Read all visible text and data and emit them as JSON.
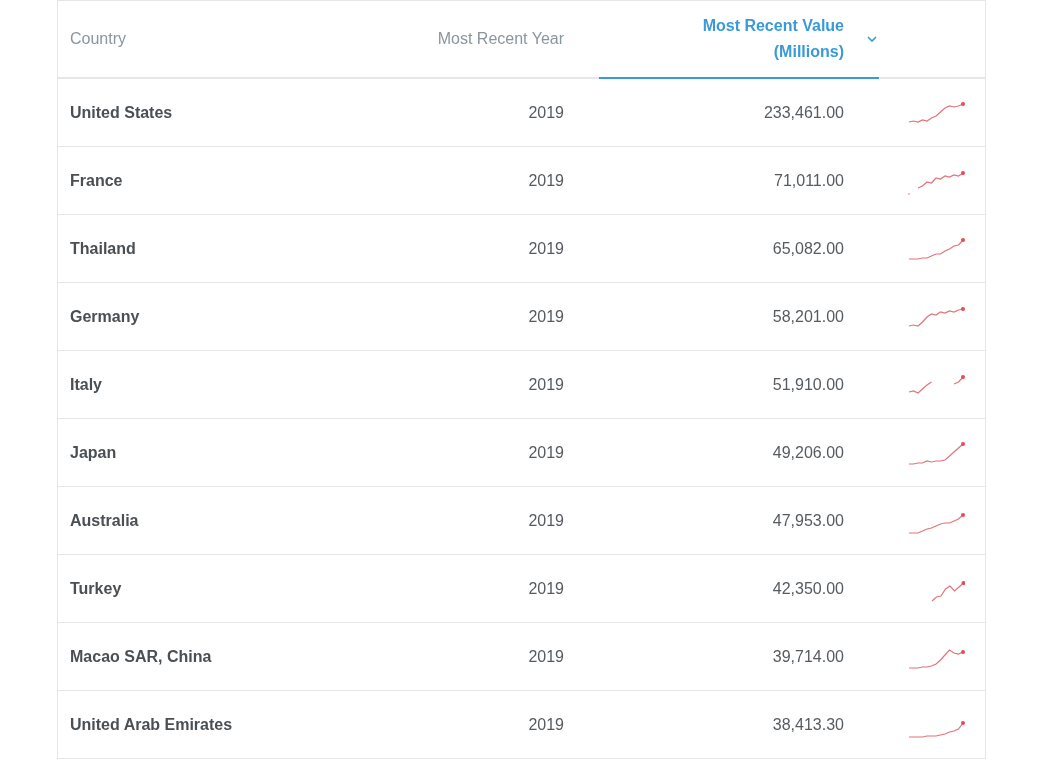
{
  "table": {
    "columns": [
      {
        "label": "Country",
        "sorted": false
      },
      {
        "label": "Most Recent Year",
        "sorted": false
      },
      {
        "label": "Most Recent Value (Millions)",
        "sorted": true
      }
    ],
    "rows": [
      {
        "country": "United States",
        "year": "2019",
        "value": "233,461.00"
      },
      {
        "country": "France",
        "year": "2019",
        "value": "71,011.00"
      },
      {
        "country": "Thailand",
        "year": "2019",
        "value": "65,082.00"
      },
      {
        "country": "Germany",
        "year": "2019",
        "value": "58,201.00"
      },
      {
        "country": "Italy",
        "year": "2019",
        "value": "51,910.00"
      },
      {
        "country": "Japan",
        "year": "2019",
        "value": "49,206.00"
      },
      {
        "country": "Australia",
        "year": "2019",
        "value": "47,953.00"
      },
      {
        "country": "Turkey",
        "year": "2019",
        "value": "42,350.00"
      },
      {
        "country": "Macao SAR, China",
        "year": "2019",
        "value": "39,714.00"
      },
      {
        "country": "United Arab Emirates",
        "year": "2019",
        "value": "38,413.30"
      }
    ]
  }
}
